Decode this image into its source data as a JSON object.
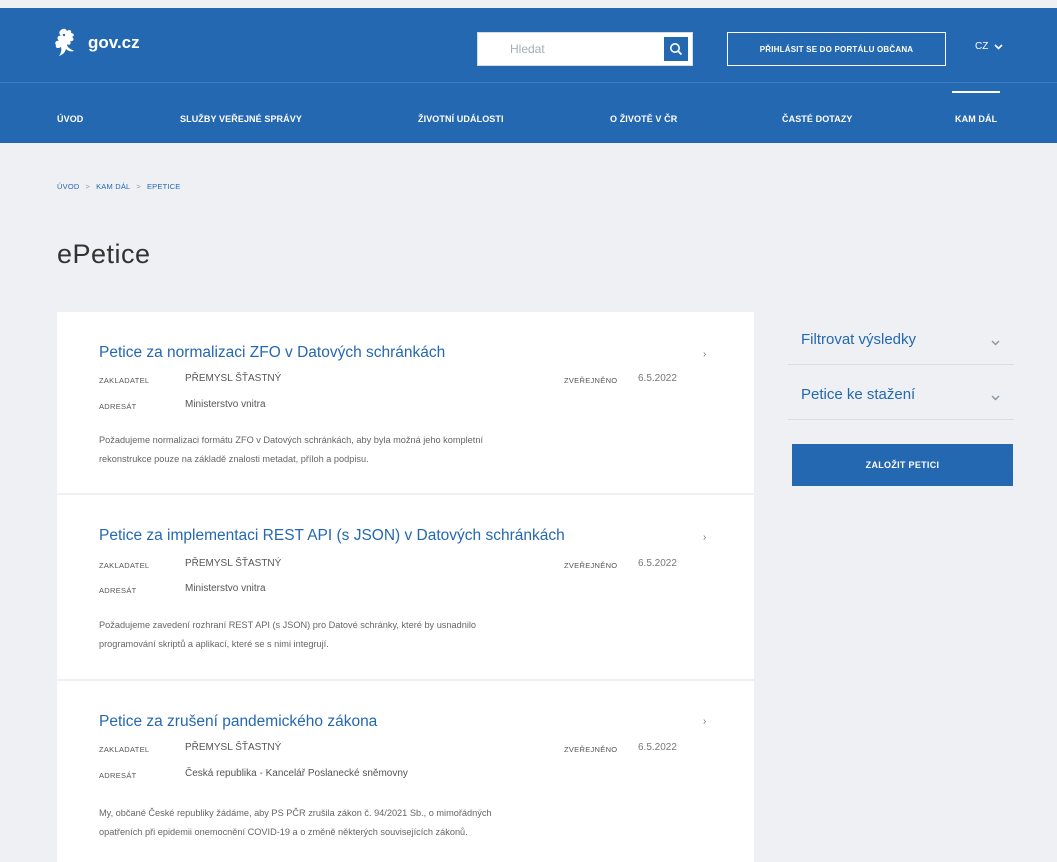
{
  "header": {
    "logo_text": "gov.cz",
    "search_placeholder": "Hledat",
    "login_label": "PŘIHLÁSIT SE DO PORTÁLU OBČANA",
    "lang": "CZ"
  },
  "nav": {
    "items": [
      {
        "label": "ÚVOD"
      },
      {
        "label": "SLUŽBY VEŘEJNÉ SPRÁVY"
      },
      {
        "label": "ŽIVOTNÍ UDÁLOSTI"
      },
      {
        "label": "O ŽIVOTĚ V ČR"
      },
      {
        "label": "ČASTÉ DOTAZY"
      },
      {
        "label": "KAM DÁL"
      }
    ]
  },
  "breadcrumb": {
    "items": [
      "ÚVOD",
      "KAM DÁL",
      "EPETICE"
    ],
    "separator": ">"
  },
  "page": {
    "title": "ePetice"
  },
  "labels": {
    "founder": "ZAKLADATEL",
    "addressee": "ADRESÁT",
    "published": "ZVEŘEJNĚNO"
  },
  "petitions": [
    {
      "title": "Petice za normalizaci ZFO v Datových schránkách",
      "founder": "PŘEMYSL ŠŤASTNÝ",
      "addressee": "Ministerstvo vnitra",
      "published": "6.5.2022",
      "description_line1": "Požadujeme normalizaci formátu ZFO v Datových schránkách, aby byla možná jeho kompletní",
      "description_line2": "rekonstrukce pouze na základě znalosti metadat, příloh a podpisu."
    },
    {
      "title": "Petice za implementaci REST API (s JSON) v Datových schránkách",
      "founder": "PŘEMYSL ŠŤASTNÝ",
      "addressee": "Ministerstvo vnitra",
      "published": "6.5.2022",
      "description_line1": "Požadujeme zavedení rozhraní REST API (s JSON) pro Datové schránky, které by usnadnilo",
      "description_line2": "programování skriptů a aplikací, které se s nimi integrují."
    },
    {
      "title": "Petice za zrušení pandemického zákona",
      "founder": "PŘEMYSL ŠŤASTNÝ",
      "addressee": "Česká republika - Kancelář Poslanecké sněmovny",
      "published": "6.5.2022",
      "description_line1": "My, občané České republiky žádáme, aby PS PČR zrušila zákon č. 94/2021 Sb., o mimořádných",
      "description_line2": "opatřeních při epidemii onemocnění COVID-19 a o změně některých souvisejících zákonů."
    }
  ],
  "sidebar": {
    "filter_label": "Filtrovat výsledky",
    "download_label": "Petice ke stažení",
    "create_label": "ZALOŽIT PETICI"
  },
  "colors": {
    "brand": "#2468b1",
    "background": "#eef0f3"
  }
}
